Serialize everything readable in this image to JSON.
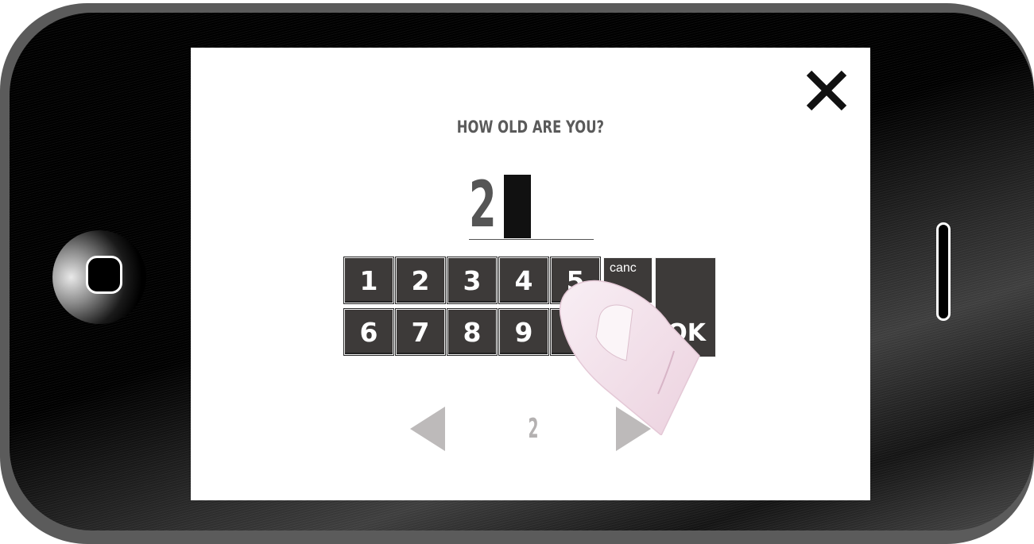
{
  "prompt": {
    "question": "HOW OLD ARE YOU?"
  },
  "age_input": {
    "value": "2"
  },
  "keypad": {
    "row1": [
      "1",
      "2",
      "3",
      "4",
      "5"
    ],
    "row2": [
      "6",
      "7",
      "8",
      "9",
      ""
    ],
    "cancel_label": "canc",
    "ok_label": "OK"
  },
  "pagination": {
    "current_page": "2"
  },
  "icons": {
    "close": "close-icon",
    "prev": "left-arrow-icon",
    "next": "right-arrow-icon",
    "home": "home-button-icon"
  },
  "colors": {
    "key_background": "#3d3a39",
    "heading_text": "#5a5a5a",
    "pager_gray": "#b4b1b1",
    "finger_pink": "#f6e6ee"
  }
}
